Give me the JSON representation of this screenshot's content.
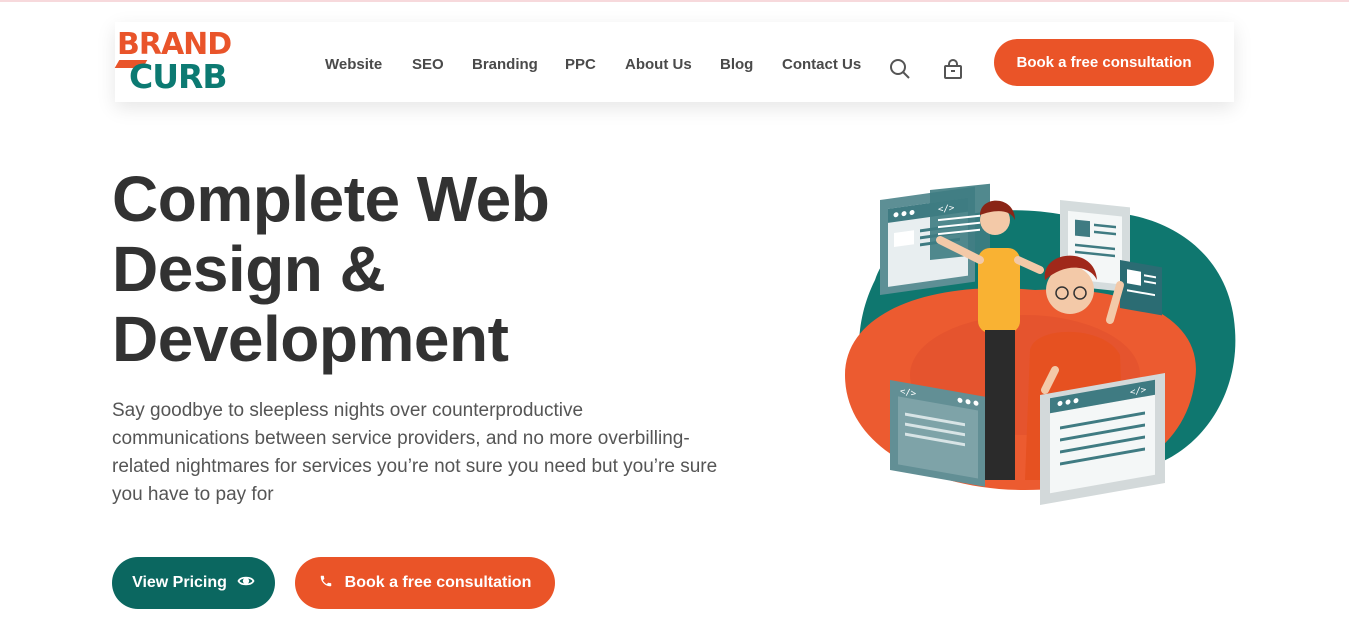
{
  "header": {
    "logo_line1": "BRAND",
    "logo_line2": "CURB",
    "nav": [
      "Website",
      "SEO",
      "Branding",
      "PPC",
      "About Us",
      "Blog",
      "Contact Us"
    ],
    "cta": "Book a free consultation",
    "icons": [
      "search-icon",
      "bag-icon"
    ]
  },
  "hero": {
    "title_lines": [
      "Complete Web",
      "Design &",
      "Development"
    ],
    "description": "Say goodbye to sleepless nights over counterproductive communications between service providers, and no more overbilling-related nightmares for services you’re not sure you need but you’re sure you have to pay for",
    "btn_pricing": "View Pricing",
    "btn_pricing_icon": "eye-icon",
    "btn_consult": "Book a free consultation",
    "btn_consult_icon": "phone-icon"
  },
  "colors": {
    "accent": "#ea5428",
    "teal": "#0b6760",
    "text": "#323232"
  }
}
